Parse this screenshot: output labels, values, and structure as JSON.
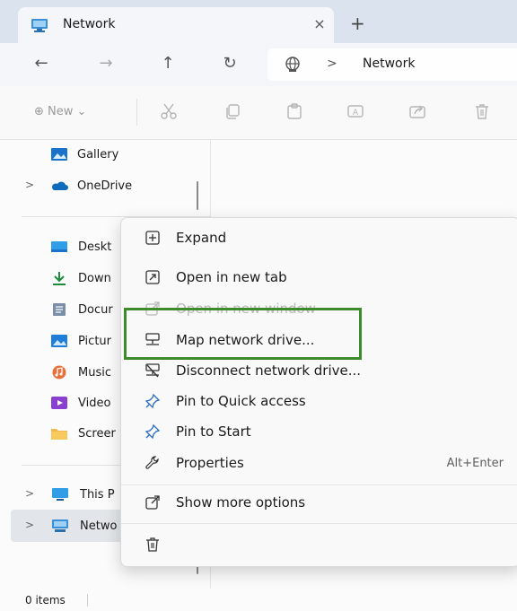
{
  "tab": {
    "title": "Network",
    "close_glyph": "×",
    "new_tab_glyph": "+"
  },
  "nav": {
    "back_glyph": "←",
    "forward_glyph": "→",
    "up_glyph": "↑",
    "refresh_glyph": "↻",
    "address_separator": ">",
    "address_text": "Network"
  },
  "command_bar": {
    "new_label": "⊕ New ⌄"
  },
  "sidebar": {
    "gallery": "Gallery",
    "onedrive": "OneDrive",
    "desktop": "Deskt",
    "downloads": "Down",
    "documents": "Docur",
    "pictures": "Pictur",
    "music": "Music",
    "videos": "Video",
    "screenshots": "Screer",
    "this_pc": "This P",
    "network": "Netwo",
    "chevron": ">"
  },
  "context_menu": {
    "expand": "Expand",
    "open_new_tab": "Open in new tab",
    "open_new_window": "Open in new window",
    "map_network_drive": "Map network drive...",
    "disconnect_network_drive": "Disconnect network drive...",
    "pin_quick_access": "Pin to Quick access",
    "pin_start": "Pin to Start",
    "properties": "Properties",
    "properties_shortcut": "Alt+Enter",
    "show_more_options": "Show more options"
  },
  "status": {
    "items_count": "0 items"
  },
  "colors": {
    "highlight_box": "#3c8c2a",
    "accent_blue": "#0067c0",
    "tab_strip": "#dbe4ee"
  }
}
